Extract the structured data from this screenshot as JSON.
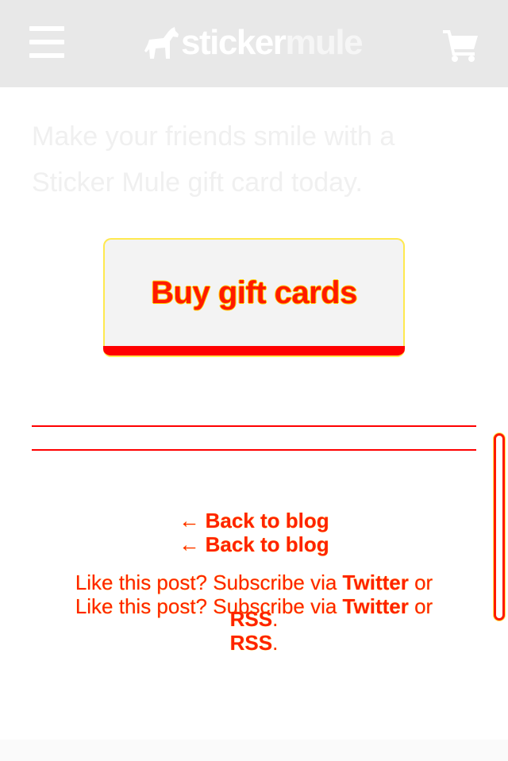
{
  "header": {
    "logo_part1": "sticker",
    "logo_part2": "mule"
  },
  "promo": {
    "text": "Make your friends smile with a Sticker Mule gift card today."
  },
  "gift_button": {
    "label": "Buy gift cards"
  },
  "footer": {
    "back_link": "← Back to blog",
    "subscribe_prefix": "Like this post? Subscribe via ",
    "twitter_label": "Twitter",
    "subscribe_or": " or",
    "rss_label": "RSS",
    "rss_suffix": "."
  },
  "colors": {
    "header_bg": "#e8e8e8",
    "accent": "#ff0000",
    "highlight": "#ffd000"
  },
  "icons": [
    "menu-icon",
    "mule-logo-icon",
    "cart-icon"
  ]
}
